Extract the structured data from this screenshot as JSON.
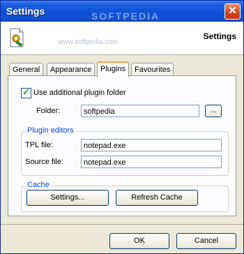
{
  "window": {
    "title": "Settings",
    "watermark": "SOFTPEDIA"
  },
  "header": {
    "title": "Settings",
    "url": "www.softpedia.com"
  },
  "tabs": [
    {
      "label": "General"
    },
    {
      "label": "Appearance"
    },
    {
      "label": "Plugins"
    },
    {
      "label": "Favourites"
    }
  ],
  "plugins": {
    "use_folder_label": "Use additional plugin folder",
    "use_folder_checked": true,
    "folder_label": "Folder:",
    "folder_value": "softpedia",
    "browse_label": "...",
    "editors_group": "Plugin editors",
    "tpl_label": "TPL file:",
    "tpl_value": "notepad.exe",
    "source_label": "Source file:",
    "source_value": "notepad.exe",
    "cache_group": "Cache",
    "settings_button": "Settings...",
    "refresh_button": "Refresh Cache"
  },
  "footer": {
    "ok": "OK",
    "cancel": "Cancel"
  },
  "colors": {
    "titlebar": "#0e4fd6",
    "group_title": "#0046d5",
    "active_tab_accent": "#f7a23f"
  }
}
